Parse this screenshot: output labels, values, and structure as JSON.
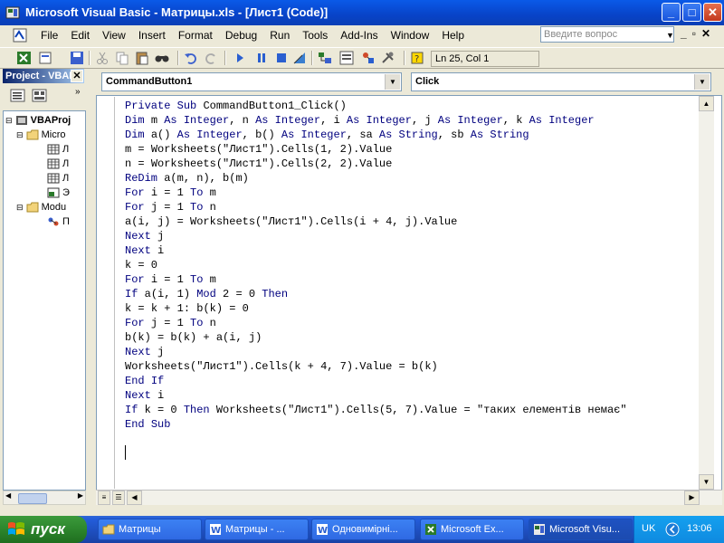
{
  "window": {
    "title": "Microsoft Visual Basic - Матрицы.xls - [Лист1 (Code)]",
    "buttons": {
      "minimize": "_",
      "maximize": "□",
      "close": "✕"
    }
  },
  "menu": {
    "items": [
      "File",
      "Edit",
      "View",
      "Insert",
      "Format",
      "Debug",
      "Run",
      "Tools",
      "Add-Ins",
      "Window",
      "Help"
    ],
    "help_placeholder": "Введите вопрос",
    "mdi_buttons": [
      "_",
      "▫",
      "✕"
    ]
  },
  "toolbar": {
    "position": "Ln 25, Col 1"
  },
  "project": {
    "title": "Project - VBAP",
    "close": "✕",
    "tree": [
      {
        "label": "VBAProj",
        "bold": true
      },
      {
        "label": "Micro"
      },
      {
        "label": "Л"
      },
      {
        "label": "Л"
      },
      {
        "label": "Л"
      },
      {
        "label": "Э"
      },
      {
        "label": "Modu"
      },
      {
        "label": "П"
      }
    ]
  },
  "code": {
    "object_combo": "CommandButton1",
    "procedure_combo": "Click",
    "lines": [
      "Private Sub CommandButton1_Click()",
      "Dim m As Integer, n As Integer, i As Integer, j As Integer, k As Integer",
      "Dim a() As Integer, b() As Integer, sa As String, sb As String",
      "m = Worksheets(\"Лист1\").Cells(1, 2).Value",
      "n = Worksheets(\"Лист1\").Cells(2, 2).Value",
      "ReDim a(m, n), b(m)",
      "For i = 1 To m",
      "For j = 1 To n",
      "a(i, j) = Worksheets(\"Лист1\").Cells(i + 4, j).Value",
      "Next j",
      "Next i",
      "k = 0",
      "For i = 1 To m",
      "If a(i, 1) Mod 2 = 0 Then",
      "k = k + 1: b(k) = 0",
      "For j = 1 To n",
      "b(k) = b(k) + a(i, j)",
      "Next j",
      "Worksheets(\"Лист1\").Cells(k + 4, 7).Value = b(k)",
      "End If",
      "Next i",
      "If k = 0 Then Worksheets(\"Лист1\").Cells(5, 7).Value = \"таких елементів немає\"",
      "End Sub"
    ],
    "keywords": [
      "Private",
      "Sub",
      "Dim",
      "As",
      "Integer",
      "String",
      "ReDim",
      "For",
      "To",
      "Next",
      "If",
      "Then",
      "End",
      "Mod"
    ],
    "keyword_color": "#00007f"
  },
  "taskbar": {
    "start_label": "пуск",
    "tasks": [
      {
        "label": "Матрицы",
        "active": false
      },
      {
        "label": "Матрицы - ...",
        "active": false
      },
      {
        "label": "Одновимірні...",
        "active": false
      },
      {
        "label": "Microsoft Ex...",
        "active": false
      },
      {
        "label": "Microsoft Visu...",
        "active": true
      }
    ],
    "language": "UK",
    "clock": "13:06"
  }
}
